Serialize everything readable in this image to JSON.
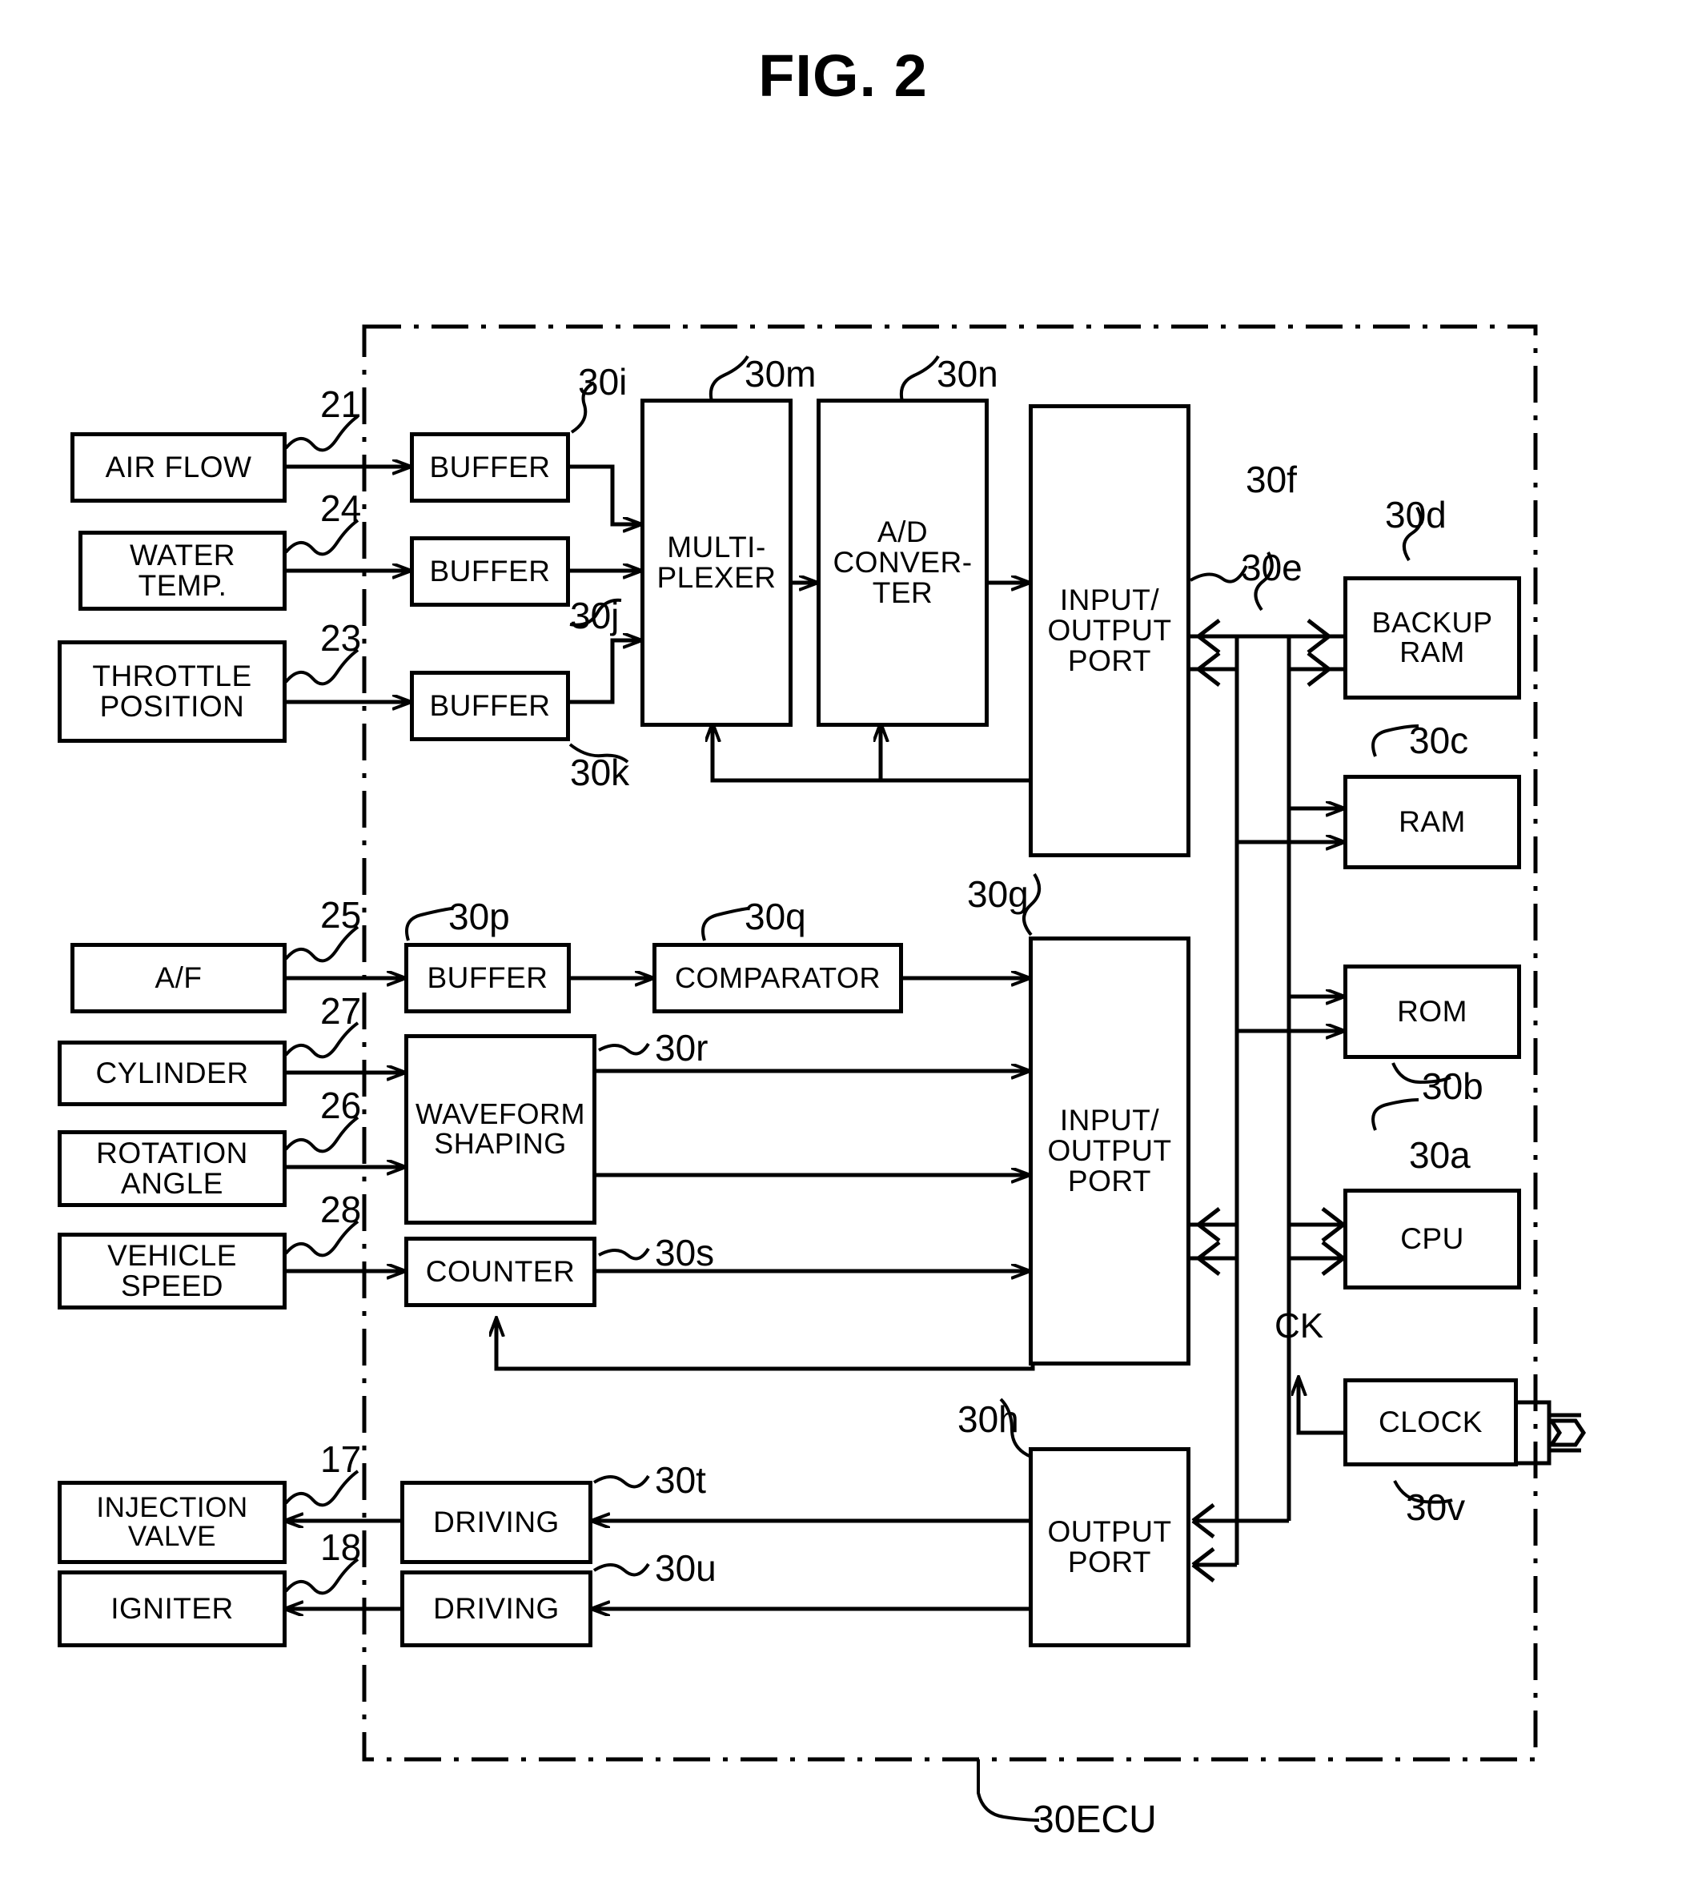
{
  "figure": {
    "title": "FIG. 2",
    "ecu_label": "30ECU",
    "clock_signal_label": "CK"
  },
  "sensors": [
    {
      "label": "AIR FLOW",
      "ref": "21"
    },
    {
      "label": "WATER\nTEMP.",
      "ref": "24"
    },
    {
      "label": "THROTTLE\nPOSITION",
      "ref": "23"
    },
    {
      "label": "A/F",
      "ref": "25"
    },
    {
      "label": "CYLINDER",
      "ref": "27"
    },
    {
      "label": "ROTATION\nANGLE",
      "ref": "26"
    },
    {
      "label": "VEHICLE\nSPEED",
      "ref": "28"
    }
  ],
  "actuators": [
    {
      "label": "INJECTION\nVALVE",
      "ref": "17"
    },
    {
      "label": "IGNITER",
      "ref": "18"
    }
  ],
  "ecu_blocks": [
    {
      "label": "BUFFER",
      "ref": "30i"
    },
    {
      "label": "BUFFER",
      "ref": "30j"
    },
    {
      "label": "BUFFER",
      "ref": "30k"
    },
    {
      "label": "MULTI-\nPLEXER",
      "ref": "30m"
    },
    {
      "label": "A/D\nCONVER-\nTER",
      "ref": "30n"
    },
    {
      "label": "INPUT/\nOUTPUT\nPORT",
      "ref": "30f"
    },
    {
      "label": "BUFFER",
      "ref": "30p"
    },
    {
      "label": "COMPARATOR",
      "ref": "30q"
    },
    {
      "label": "WAVEFORM\nSHAPING",
      "ref": "30r"
    },
    {
      "label": "COUNTER",
      "ref": "30s"
    },
    {
      "label": "INPUT/\nOUTPUT\nPORT",
      "ref": "30g"
    },
    {
      "label": "DRIVING",
      "ref": "30t"
    },
    {
      "label": "DRIVING",
      "ref": "30u"
    },
    {
      "label": "OUTPUT\nPORT",
      "ref": "30h"
    },
    {
      "label": "CLOCK",
      "ref": "30v"
    }
  ],
  "memory_blocks": [
    {
      "label": "BACKUP\nRAM",
      "ref": "30d"
    },
    {
      "label": "RAM",
      "ref": "30c"
    },
    {
      "label": "ROM",
      "ref": "30b"
    },
    {
      "label": "CPU",
      "ref": "30a"
    }
  ],
  "bus": {
    "ref": "30e"
  },
  "colors": {
    "ink": "#000000",
    "paper": "#ffffff"
  }
}
